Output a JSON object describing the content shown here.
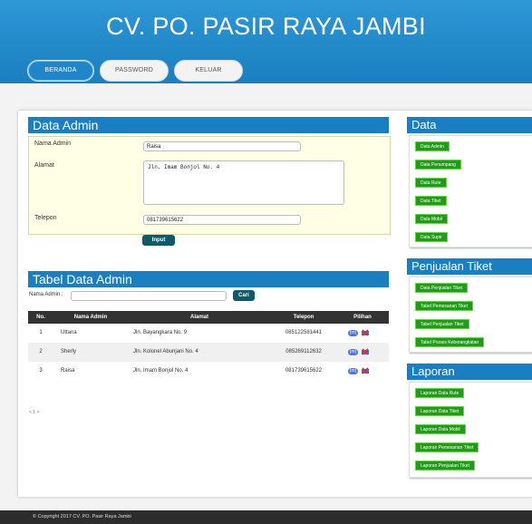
{
  "site": {
    "title": "CV. PO. PASIR RAYA JAMBI"
  },
  "nav": [
    {
      "label": "BERANDA"
    },
    {
      "label": "PASSWORD"
    },
    {
      "label": "KELUAR"
    }
  ],
  "form": {
    "heading": "Data Admin",
    "name_label": "Nama Admin",
    "name_value": "Raisa",
    "address_label": "Alamat",
    "address_value": "Jln. Imam Bonjol No. 4",
    "phone_label": "Telepon",
    "phone_value": "081739615622",
    "submit_label": "Input"
  },
  "table": {
    "heading": "Tabel Data Admin",
    "search_label": "Nama Admin :",
    "search_value": "",
    "search_button": "Cari",
    "columns": [
      "No.",
      "Nama Admin",
      "Alamat",
      "Telepon",
      "Pilihan"
    ],
    "rows": [
      {
        "no": "1",
        "name": "Uttana",
        "address": "Jln. Bayangkara No. 9",
        "phone": "085122581441"
      },
      {
        "no": "2",
        "name": "Sherly",
        "address": "Jln. Kolonel Abunjani No. 4",
        "phone": "085269112632"
      },
      {
        "no": "3",
        "name": "Raisa",
        "address": "Jln. Imam Bonjol No. 4",
        "phone": "081739615622"
      }
    ],
    "edit_icon_text": "(m)",
    "pager": "< 1 >"
  },
  "sidebar": {
    "data": {
      "heading": "Data",
      "items": [
        "Data Admin",
        "Data Penumpang",
        "Data Rute",
        "Data Tiket",
        "Data Mobil",
        "Data Supir"
      ]
    },
    "sales": {
      "heading": "Penjualan Tiket",
      "items": [
        "Data Penjualan Tiket",
        "Tabel Pemesanan Tiket",
        "Tabel Penjualan Tiket",
        "Tabel Proses Keberangkatan"
      ]
    },
    "reports": {
      "heading": "Laporan",
      "items": [
        "Laporan Data Rute",
        "Laporan Data Tiket",
        "Laporan Data Mobil",
        "Laporan Pemesanan Tiket",
        "Laporan Penjualan Tiket"
      ]
    }
  },
  "footer": {
    "text": "© Copyright 2017 CV. PO. Pasir Raya Jambi"
  },
  "colors": {
    "header": "#1a7fc0",
    "accent_green": "#1e9e16",
    "form_bg": "#ffffe6",
    "table_head": "#333333"
  },
  "icons": [
    "edit-icon",
    "delete-icon"
  ]
}
